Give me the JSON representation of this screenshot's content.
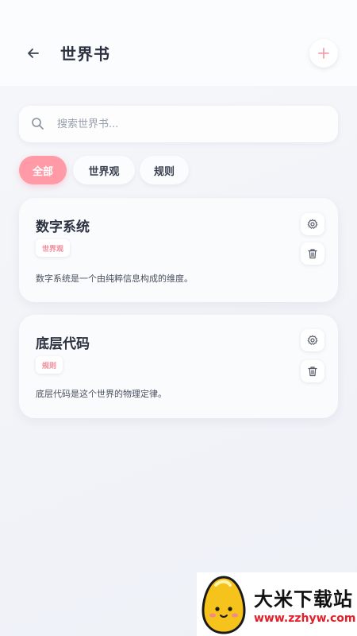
{
  "header": {
    "title": "世界书",
    "back_icon": "arrow-left-icon",
    "add_icon": "plus-icon"
  },
  "search": {
    "placeholder": "搜索世界书...",
    "value": ""
  },
  "tabs": [
    {
      "label": "全部",
      "active": true
    },
    {
      "label": "世界观",
      "active": false
    },
    {
      "label": "规则",
      "active": false
    }
  ],
  "entries": [
    {
      "title": "数字系统",
      "tag": "世界观",
      "description": "数字系统是一个由纯粹信息构成的维度。"
    },
    {
      "title": "底层代码",
      "tag": "规则",
      "description": "底层代码是这个世界的物理定律。"
    }
  ],
  "watermark": {
    "name": "大米下载站",
    "url": "www.zzhyw.com"
  },
  "colors": {
    "accent": "#ff9aa6",
    "tag_text": "#f08a98",
    "title_text": "#2c3140"
  }
}
